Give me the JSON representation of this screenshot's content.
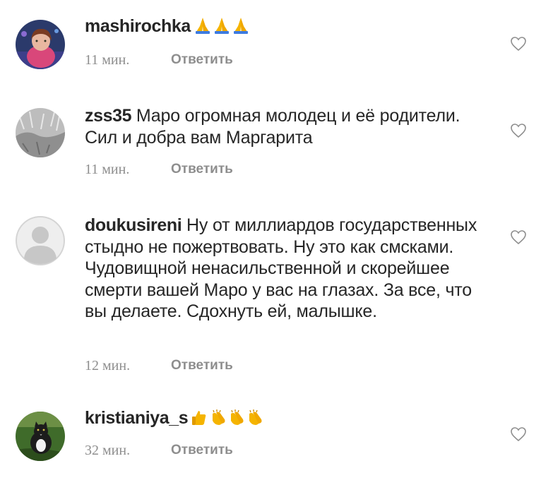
{
  "comments": [
    {
      "username": "mashirochka",
      "text": "",
      "emoji": [
        "folded-hands",
        "folded-hands",
        "folded-hands"
      ],
      "time": "11 мин.",
      "reply": "Ответить"
    },
    {
      "username": "zss35",
      "text": "Маро огромная молодец и её родители. Сил и добра вам Маргарита",
      "emoji": [],
      "time": "11 мин.",
      "reply": "Ответить"
    },
    {
      "username": "doukusireni",
      "text": "Ну от миллиардов государственных стыдно не пожертвовать. Ну это как смсками. Чудовищной ненасильственной и скорейшее смерти вашей Маро у вас на глазах. За все, что вы делаете. Сдохнуть ей, малышке.",
      "emoji": [],
      "time": "12 мин.",
      "reply": "Ответить"
    },
    {
      "username": "kristianiya_s",
      "text": "",
      "emoji": [
        "thumbs-up",
        "clapping-hands",
        "clapping-hands",
        "clapping-hands"
      ],
      "time": "32 мин.",
      "reply": "Ответить"
    }
  ],
  "icons": {
    "like": "heart-outline-icon"
  },
  "colors": {
    "text": "#262626",
    "meta": "#8e8e8e",
    "heart": "#8e8e8e",
    "emoji": "#f5b400"
  }
}
